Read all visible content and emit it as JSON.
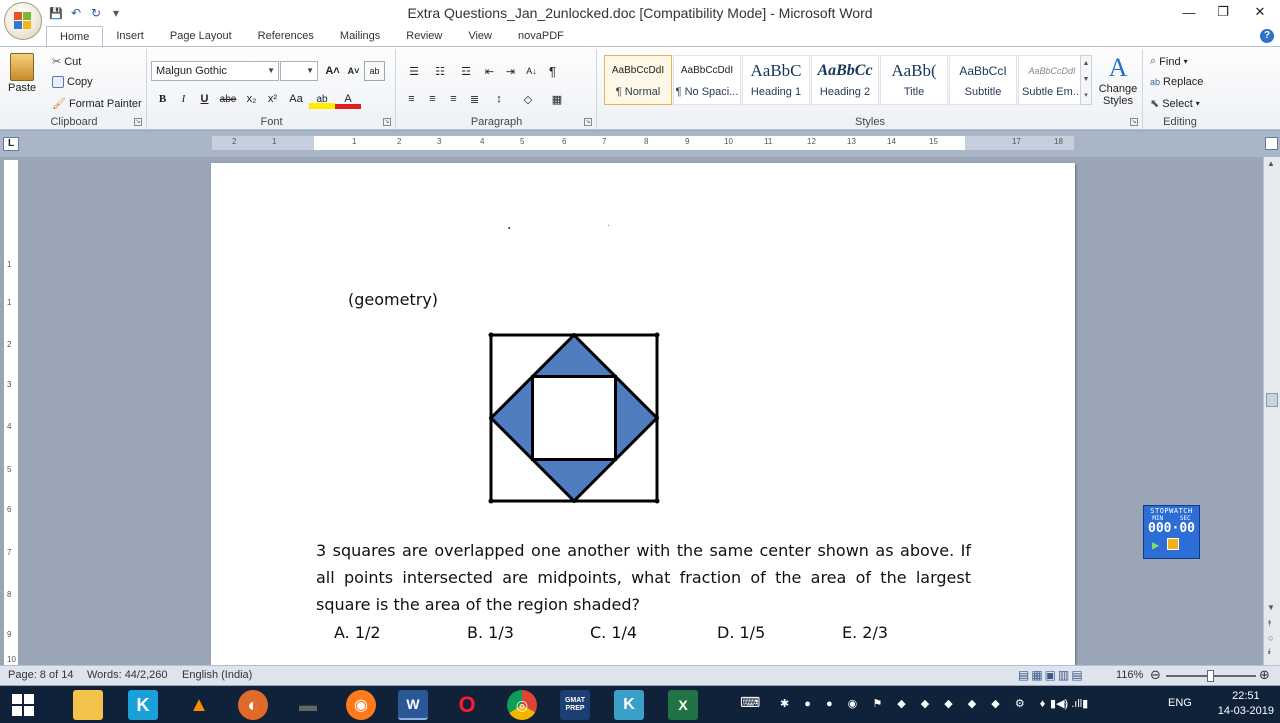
{
  "window": {
    "title": "Extra Questions_Jan_2unlocked.doc [Compatibility Mode] - Microsoft Word",
    "minimize": "—",
    "restore": "❐",
    "close": "✕"
  },
  "qat": {
    "save": "💾",
    "undo": "↶",
    "redo": "↻",
    "customize": "▾"
  },
  "tabs": [
    "Home",
    "Insert",
    "Page Layout",
    "References",
    "Mailings",
    "Review",
    "View",
    "novaPDF"
  ],
  "help": "?",
  "clipboard": {
    "label": "Clipboard",
    "paste": "Paste",
    "cut": "Cut",
    "copy": "Copy",
    "format_painter": "Format Painter"
  },
  "font": {
    "label": "Font",
    "name": "Malgun Gothic",
    "size": "",
    "grow": "A˄",
    "shrink": "A˅",
    "clear": "ab",
    "bold": "B",
    "italic": "I",
    "underline": "U",
    "strike": "abe",
    "subscript": "x₂",
    "superscript": "x²",
    "case": "Aa",
    "highlight": "ab",
    "color": "A"
  },
  "paragraph": {
    "label": "Paragraph",
    "show_marks": "¶",
    "sort": "A↓"
  },
  "styles": {
    "label": "Styles",
    "items": [
      {
        "preview": "AaBbCcDdI",
        "name": "¶ Normal"
      },
      {
        "preview": "AaBbCcDdI",
        "name": "¶ No Spaci..."
      },
      {
        "preview": "AaBbC",
        "name": "Heading 1"
      },
      {
        "preview": "AaBbCc",
        "name": "Heading 2"
      },
      {
        "preview": "AaBb(",
        "name": "Title"
      },
      {
        "preview": "AaBbCcI",
        "name": "Subtitle"
      },
      {
        "preview": "AaBbCcDdI",
        "name": "Subtle Em..."
      }
    ],
    "change_styles": "Change Styles"
  },
  "editing": {
    "label": "Editing",
    "find": "Find",
    "replace": "Replace",
    "select": "Select"
  },
  "ruler": {
    "h_numbers": [
      "2",
      "1",
      "1",
      "2",
      "3",
      "4",
      "5",
      "6",
      "7",
      "8",
      "9",
      "10",
      "11",
      "12",
      "13",
      "14",
      "15",
      "17",
      "18"
    ],
    "v_numbers": [
      "1",
      "1",
      "2",
      "3",
      "4",
      "5",
      "6",
      "7",
      "8",
      "9",
      "10"
    ],
    "corner": "L"
  },
  "document": {
    "dots": [
      "·",
      "·"
    ],
    "tag": "(geometry)",
    "question_lines": [
      "3 squares are overlapped one another with the same center shown as above. If",
      "all points intersected are midpoints, what fraction of the area of the largest",
      "square is the area of the region shaded?"
    ],
    "options": [
      "A. 1/2",
      "B. 1/3",
      "C. 1/4",
      "D. 1/5",
      "E. 2/3"
    ],
    "figure_colors": {
      "shaded": "#4f7cbf",
      "stroke": "#000000"
    }
  },
  "stopwatch": {
    "title": "STOPWATCH",
    "min_label": "MIN",
    "sec_label": "SEC",
    "time": "000·00"
  },
  "status": {
    "page": "Page: 8 of 14",
    "words": "Words: 44/2,260",
    "language": "English (India)",
    "zoom": "116%",
    "zoom_level": 0.5
  },
  "taskbar": {
    "apps": [
      "K",
      "▲",
      "◐",
      "▬",
      "◉",
      "W",
      "O",
      "◎",
      "GMAT PREP",
      "K",
      "X"
    ],
    "tray_lang": "ENG",
    "time": "22:51",
    "date": "14-03-2019"
  }
}
